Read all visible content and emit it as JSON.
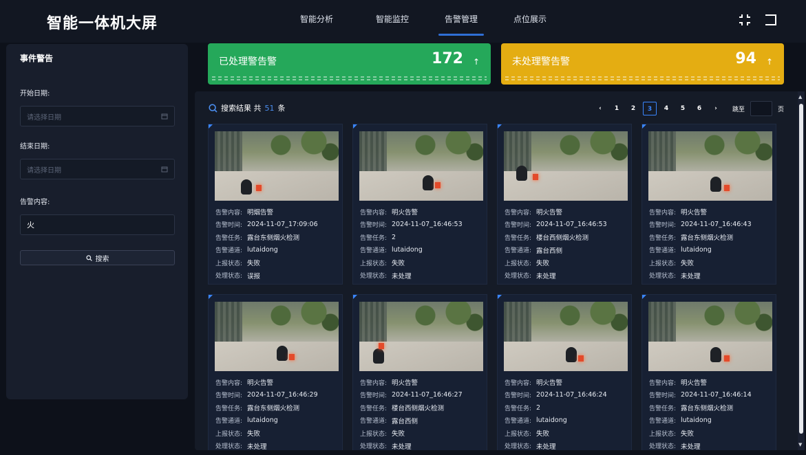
{
  "header": {
    "title": "智能一体机大屏",
    "nav": [
      {
        "label": "智能分析",
        "active": false
      },
      {
        "label": "智能监控",
        "active": false
      },
      {
        "label": "告警管理",
        "active": true
      },
      {
        "label": "点位展示",
        "active": false
      }
    ],
    "icons": [
      "fullscreen-exit-icon",
      "logout-icon"
    ]
  },
  "sidebar": {
    "title": "事件警告",
    "start_label": "开始日期:",
    "start_placeholder": "请选择日期",
    "end_label": "结束日期:",
    "end_placeholder": "请选择日期",
    "content_label": "告警内容:",
    "content_value": "火",
    "search_label": "搜索"
  },
  "stats": {
    "processed": {
      "label": "已处理警告警",
      "value": "172",
      "color": "#25a85a"
    },
    "unprocessed": {
      "label": "未处理警告警",
      "value": "94",
      "color": "#e4ad12"
    }
  },
  "results": {
    "prefix": "搜索结果 共",
    "count": "51",
    "suffix": "条",
    "pager": {
      "prev": "‹",
      "pages": [
        "1",
        "2",
        "3",
        "4",
        "5",
        "6"
      ],
      "current": "3",
      "next": "›",
      "jump_label": "跳至",
      "page_label": "页"
    },
    "field_labels": {
      "content": "告警内容:",
      "time": "告警时间:",
      "task": "告警任务:",
      "channel": "告警通道:",
      "report": "上报状态:",
      "status": "处理状态:"
    },
    "cards": [
      {
        "content": "明烟告警",
        "time": "2024-11-07_17:09:06",
        "task": "露台东侧烟火检测",
        "channel": "lutaidong",
        "report": "失败",
        "status": "误报"
      },
      {
        "content": "明火告警",
        "time": "2024-11-07_16:46:53",
        "task": "2",
        "channel": "lutaidong",
        "report": "失败",
        "status": "未处理"
      },
      {
        "content": "明火告警",
        "time": "2024-11-07_16:46:53",
        "task": "楼台西侧烟火检测",
        "channel": "露台西侧",
        "report": "失败",
        "status": "未处理"
      },
      {
        "content": "明火告警",
        "time": "2024-11-07_16:46:43",
        "task": "露台东侧烟火检测",
        "channel": "lutaidong",
        "report": "失败",
        "status": "未处理"
      },
      {
        "content": "明火告警",
        "time": "2024-11-07_16:46:29",
        "task": "露台东侧烟火检测",
        "channel": "lutaidong",
        "report": "失败",
        "status": "未处理"
      },
      {
        "content": "明火告警",
        "time": "2024-11-07_16:46:27",
        "task": "楼台西侧烟火检测",
        "channel": "露台西侧",
        "report": "失败",
        "status": "未处理"
      },
      {
        "content": "明火告警",
        "time": "2024-11-07_16:46:24",
        "task": "2",
        "channel": "lutaidong",
        "report": "失败",
        "status": "未处理"
      },
      {
        "content": "明火告警",
        "time": "2024-11-07_16:46:14",
        "task": "露台东侧烟火检测",
        "channel": "lutaidong",
        "report": "失败",
        "status": "未处理"
      }
    ]
  }
}
